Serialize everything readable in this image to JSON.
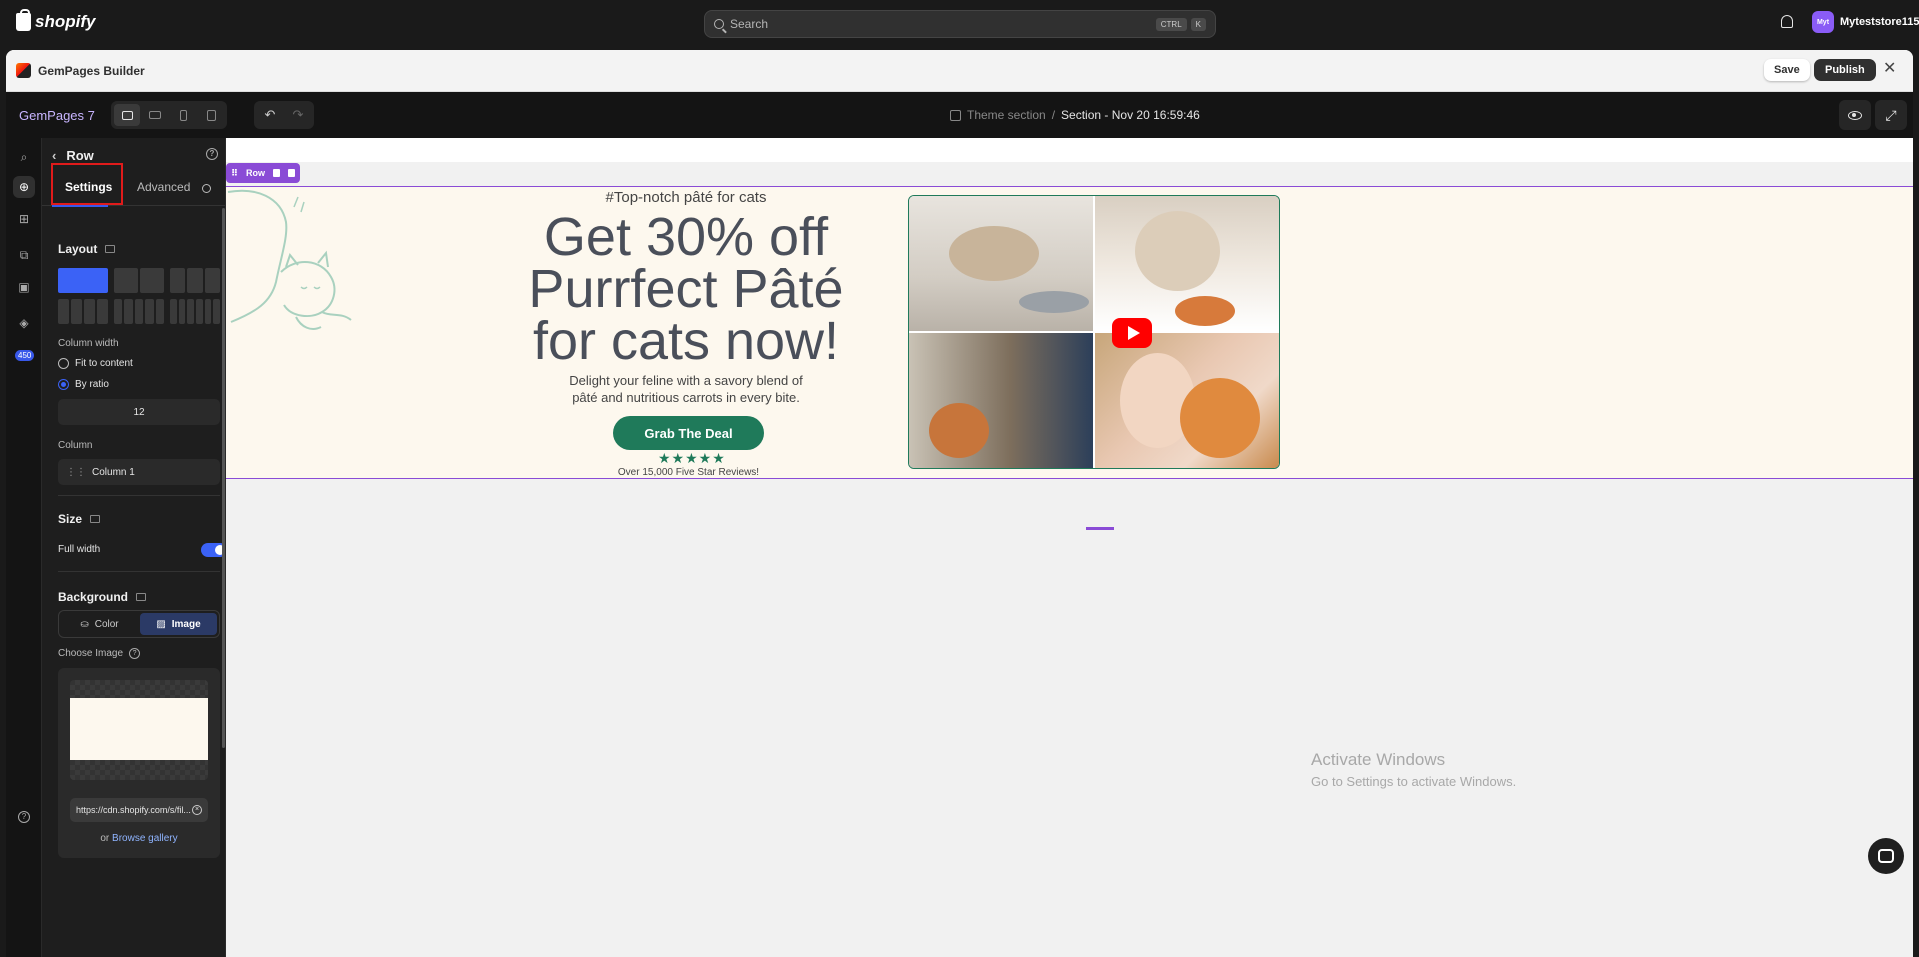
{
  "topbar": {
    "brand": "shopify",
    "search_placeholder": "Search",
    "shortcut_keys": [
      "CTRL",
      "K"
    ],
    "user_initials": "Myt",
    "user_name": "Myteststore115"
  },
  "app": {
    "title": "GemPages Builder",
    "save_label": "Save",
    "publish_label": "Publish",
    "close_icon": "close-icon"
  },
  "editor": {
    "project_name": "GemPages 7",
    "breadcrumb_root": "Theme section",
    "breadcrumb_sep": "/",
    "breadcrumb_current": "Section - Nov 20 16:59:46",
    "undo_icon": "↶",
    "redo_icon": "↷",
    "expand_icon": "⤢"
  },
  "rail": {
    "badge": "450"
  },
  "panel": {
    "title": "Row",
    "tabs": [
      "Settings",
      "Advanced"
    ],
    "layout_title": "Layout",
    "column_width_label": "Column width",
    "fit_to_content": "Fit to content",
    "by_ratio": "By ratio",
    "ratio_value": "12",
    "column_label": "Column",
    "column_item": "Column 1",
    "size_title": "Size",
    "full_width_label": "Full width",
    "full_width_on": true,
    "background_title": "Background",
    "bg_options": [
      "Color",
      "Image"
    ],
    "bg_selected": "Image",
    "choose_image_label": "Choose Image",
    "image_url": "https://cdn.shopify.com/s/fil...",
    "or_text": "or",
    "browse_gallery": "Browse gallery"
  },
  "canvas": {
    "row_tag": "Row",
    "hero_tagline": "#Top-notch pâté for cats",
    "hero_heading": "Get 30% off Purrfect Pâté for cats now!",
    "hero_subtext": "Delight your feline with a savory blend of pâté and nutritious carrots in every bite.",
    "cta_label": "Grab The Deal",
    "stars": "★★★★★",
    "reviews_text": "Over 15,000 Five Star Reviews!",
    "accent_color": "#1f7a5a",
    "selection_color": "#8a4bd6"
  },
  "watermark": {
    "line1": "Activate Windows",
    "line2": "Go to Settings to activate Windows."
  }
}
